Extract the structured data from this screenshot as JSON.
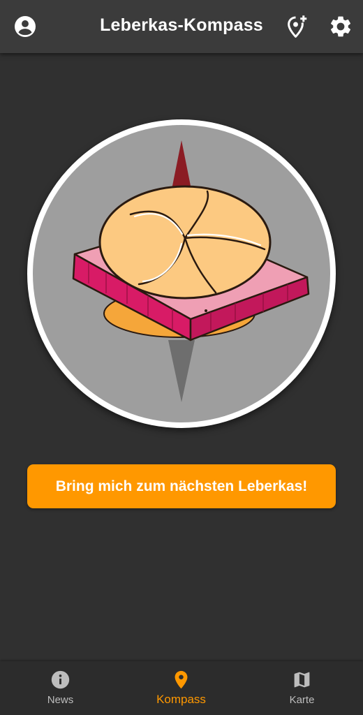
{
  "appbar": {
    "title": "Leberkas-Kompass",
    "icons": {
      "left": "account-circle-icon",
      "right1": "add-location-icon",
      "right2": "settings-gear-icon"
    }
  },
  "compass": {
    "needle_north_color": "#8b1c24",
    "needle_south_color": "#6e6e6e",
    "image": "leberkas-semmel"
  },
  "cta": {
    "label": "Bring mich zum nächsten Leberkas!",
    "color": "#ff9800"
  },
  "bottom_nav": {
    "active_color": "#ff9800",
    "items": [
      {
        "label": "News",
        "icon": "info-icon",
        "active": false
      },
      {
        "label": "Kompass",
        "icon": "location-pin-icon",
        "active": true
      },
      {
        "label": "Karte",
        "icon": "map-icon",
        "active": false
      }
    ]
  }
}
